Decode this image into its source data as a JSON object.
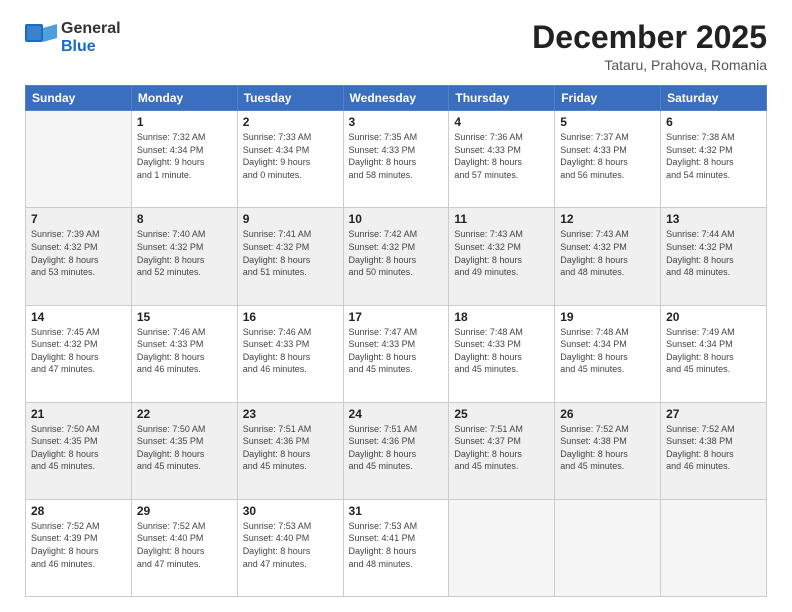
{
  "header": {
    "logo_general": "General",
    "logo_blue": "Blue",
    "month": "December 2025",
    "location": "Tataru, Prahova, Romania"
  },
  "days_of_week": [
    "Sunday",
    "Monday",
    "Tuesday",
    "Wednesday",
    "Thursday",
    "Friday",
    "Saturday"
  ],
  "weeks": [
    [
      {
        "day": "",
        "info": ""
      },
      {
        "day": "1",
        "info": "Sunrise: 7:32 AM\nSunset: 4:34 PM\nDaylight: 9 hours\nand 1 minute."
      },
      {
        "day": "2",
        "info": "Sunrise: 7:33 AM\nSunset: 4:34 PM\nDaylight: 9 hours\nand 0 minutes."
      },
      {
        "day": "3",
        "info": "Sunrise: 7:35 AM\nSunset: 4:33 PM\nDaylight: 8 hours\nand 58 minutes."
      },
      {
        "day": "4",
        "info": "Sunrise: 7:36 AM\nSunset: 4:33 PM\nDaylight: 8 hours\nand 57 minutes."
      },
      {
        "day": "5",
        "info": "Sunrise: 7:37 AM\nSunset: 4:33 PM\nDaylight: 8 hours\nand 56 minutes."
      },
      {
        "day": "6",
        "info": "Sunrise: 7:38 AM\nSunset: 4:32 PM\nDaylight: 8 hours\nand 54 minutes."
      }
    ],
    [
      {
        "day": "7",
        "info": "Sunrise: 7:39 AM\nSunset: 4:32 PM\nDaylight: 8 hours\nand 53 minutes."
      },
      {
        "day": "8",
        "info": "Sunrise: 7:40 AM\nSunset: 4:32 PM\nDaylight: 8 hours\nand 52 minutes."
      },
      {
        "day": "9",
        "info": "Sunrise: 7:41 AM\nSunset: 4:32 PM\nDaylight: 8 hours\nand 51 minutes."
      },
      {
        "day": "10",
        "info": "Sunrise: 7:42 AM\nSunset: 4:32 PM\nDaylight: 8 hours\nand 50 minutes."
      },
      {
        "day": "11",
        "info": "Sunrise: 7:43 AM\nSunset: 4:32 PM\nDaylight: 8 hours\nand 49 minutes."
      },
      {
        "day": "12",
        "info": "Sunrise: 7:43 AM\nSunset: 4:32 PM\nDaylight: 8 hours\nand 48 minutes."
      },
      {
        "day": "13",
        "info": "Sunrise: 7:44 AM\nSunset: 4:32 PM\nDaylight: 8 hours\nand 48 minutes."
      }
    ],
    [
      {
        "day": "14",
        "info": "Sunrise: 7:45 AM\nSunset: 4:32 PM\nDaylight: 8 hours\nand 47 minutes."
      },
      {
        "day": "15",
        "info": "Sunrise: 7:46 AM\nSunset: 4:33 PM\nDaylight: 8 hours\nand 46 minutes."
      },
      {
        "day": "16",
        "info": "Sunrise: 7:46 AM\nSunset: 4:33 PM\nDaylight: 8 hours\nand 46 minutes."
      },
      {
        "day": "17",
        "info": "Sunrise: 7:47 AM\nSunset: 4:33 PM\nDaylight: 8 hours\nand 45 minutes."
      },
      {
        "day": "18",
        "info": "Sunrise: 7:48 AM\nSunset: 4:33 PM\nDaylight: 8 hours\nand 45 minutes."
      },
      {
        "day": "19",
        "info": "Sunrise: 7:48 AM\nSunset: 4:34 PM\nDaylight: 8 hours\nand 45 minutes."
      },
      {
        "day": "20",
        "info": "Sunrise: 7:49 AM\nSunset: 4:34 PM\nDaylight: 8 hours\nand 45 minutes."
      }
    ],
    [
      {
        "day": "21",
        "info": "Sunrise: 7:50 AM\nSunset: 4:35 PM\nDaylight: 8 hours\nand 45 minutes."
      },
      {
        "day": "22",
        "info": "Sunrise: 7:50 AM\nSunset: 4:35 PM\nDaylight: 8 hours\nand 45 minutes."
      },
      {
        "day": "23",
        "info": "Sunrise: 7:51 AM\nSunset: 4:36 PM\nDaylight: 8 hours\nand 45 minutes."
      },
      {
        "day": "24",
        "info": "Sunrise: 7:51 AM\nSunset: 4:36 PM\nDaylight: 8 hours\nand 45 minutes."
      },
      {
        "day": "25",
        "info": "Sunrise: 7:51 AM\nSunset: 4:37 PM\nDaylight: 8 hours\nand 45 minutes."
      },
      {
        "day": "26",
        "info": "Sunrise: 7:52 AM\nSunset: 4:38 PM\nDaylight: 8 hours\nand 45 minutes."
      },
      {
        "day": "27",
        "info": "Sunrise: 7:52 AM\nSunset: 4:38 PM\nDaylight: 8 hours\nand 46 minutes."
      }
    ],
    [
      {
        "day": "28",
        "info": "Sunrise: 7:52 AM\nSunset: 4:39 PM\nDaylight: 8 hours\nand 46 minutes."
      },
      {
        "day": "29",
        "info": "Sunrise: 7:52 AM\nSunset: 4:40 PM\nDaylight: 8 hours\nand 47 minutes."
      },
      {
        "day": "30",
        "info": "Sunrise: 7:53 AM\nSunset: 4:40 PM\nDaylight: 8 hours\nand 47 minutes."
      },
      {
        "day": "31",
        "info": "Sunrise: 7:53 AM\nSunset: 4:41 PM\nDaylight: 8 hours\nand 48 minutes."
      },
      {
        "day": "",
        "info": ""
      },
      {
        "day": "",
        "info": ""
      },
      {
        "day": "",
        "info": ""
      }
    ]
  ]
}
